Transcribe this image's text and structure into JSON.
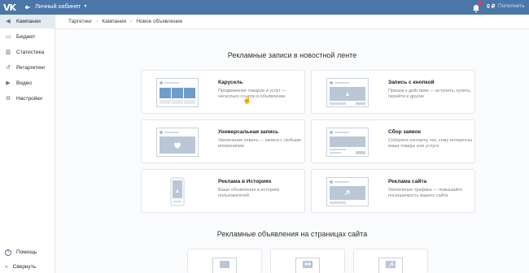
{
  "header": {
    "logo": "VK",
    "cabinet": "Личный кабинет",
    "balance": "0 ₽",
    "topup": "Пополнить"
  },
  "sidebar": {
    "items": [
      {
        "label": "Кампании",
        "icon": "megaphone-icon"
      },
      {
        "label": "Бюджет",
        "icon": "wallet-icon"
      },
      {
        "label": "Статистика",
        "icon": "chart-icon"
      },
      {
        "label": "Ретаргетинг",
        "icon": "retarget-icon"
      },
      {
        "label": "Видео",
        "icon": "video-icon"
      },
      {
        "label": "Настройки",
        "icon": "gear-icon"
      }
    ],
    "help": "Помощь",
    "collapse": "Свернуть"
  },
  "breadcrumb": [
    "Таргетинг",
    "Кампании",
    "Новое объявление"
  ],
  "feed": {
    "title": "Рекламные записи в новостной ленте",
    "cards": [
      {
        "title": "Карусель",
        "desc": "Продвижение товаров и услуг — несколько ссылок в объявлении"
      },
      {
        "title": "Запись с кнопкой",
        "desc": "Призыв к действию — вступить, купить, перейти и другие"
      },
      {
        "title": "Универсальная запись",
        "desc": "Увеличение охвата — записи с любыми вложениями"
      },
      {
        "title": "Сбор заявок",
        "desc": "Соберите контакты тех, кому интересны ваши товары или услуги"
      },
      {
        "title": "Реклама в Историях",
        "desc": "Ваши объявления в историях пользователей"
      },
      {
        "title": "Реклама сайта",
        "desc": "Увеличение трафика — повышайте посещаемость вашего сайта"
      }
    ]
  },
  "site": {
    "title": "Рекламные объявления на страницах сайта"
  },
  "colors": {
    "brand": "#4a76a8",
    "active_nav": "#e4eaf1"
  }
}
